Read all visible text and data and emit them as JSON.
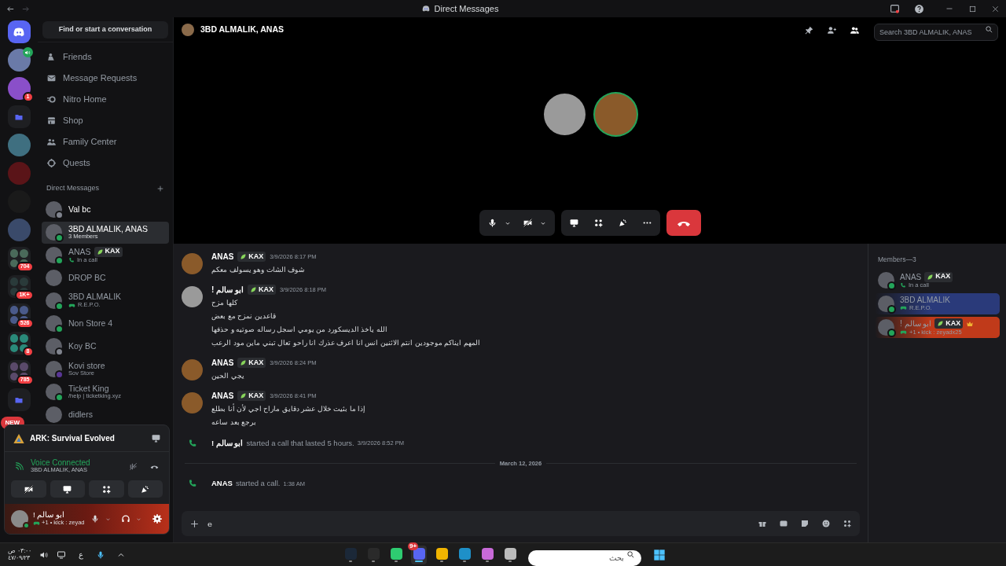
{
  "window": {
    "title": "Direct Messages"
  },
  "servers": [
    {
      "kind": "home",
      "color": "#5865f2"
    },
    {
      "kind": "avatar",
      "color": "#6a7aa8",
      "voice": true
    },
    {
      "kind": "avatar",
      "color": "#8a4fc9",
      "badge": "1"
    },
    {
      "kind": "folder",
      "color": "#5865f2"
    },
    {
      "kind": "avatar",
      "color": "#3f6f80"
    },
    {
      "kind": "avatar",
      "color": "#5a1418"
    },
    {
      "kind": "avatar",
      "color": "#1a1a1a"
    },
    {
      "kind": "avatar",
      "color": "#3a4a6a"
    },
    {
      "kind": "group",
      "color": "#4a6a5a",
      "badge": "704"
    },
    {
      "kind": "group",
      "color": "#2a3a3a",
      "badge": "1K+"
    },
    {
      "kind": "group",
      "color": "#4a5a8a",
      "badge": "526"
    },
    {
      "kind": "group",
      "color": "#2a8a7a",
      "badge": "8"
    },
    {
      "kind": "group",
      "color": "#5a4a6a",
      "badge": "785"
    },
    {
      "kind": "folder",
      "color": "#5865f2"
    },
    {
      "kind": "new",
      "color": "#da373c",
      "badge": "NEW"
    }
  ],
  "search": {
    "placeholder": "Find or start a conversation"
  },
  "nav": [
    {
      "label": "Friends"
    },
    {
      "label": "Message Requests"
    },
    {
      "label": "Nitro Home"
    },
    {
      "label": "Shop"
    },
    {
      "label": "Family Center"
    },
    {
      "label": "Quests"
    }
  ],
  "dm_header": "Direct Messages",
  "dms": [
    {
      "name": "Val bc",
      "kind": "plain",
      "color": "#80848e",
      "selected": false
    },
    {
      "name": "3BD ALMALIK, ANAS",
      "sub": "3 Members",
      "kind": "text",
      "color": "#23a55a",
      "selected": true
    },
    {
      "name": "ANAS",
      "sub": "In a call",
      "tag": "KAX",
      "kind": "call",
      "color": "#23a55a",
      "selected": false
    },
    {
      "name": "DROP BC",
      "kind": "plain",
      "selected": false
    },
    {
      "name": "3BD ALMALIK",
      "sub": "R.E.P.O.",
      "kind": "game",
      "color": "#23a55a",
      "selected": false
    },
    {
      "name": "Non Store 4",
      "kind": "plain",
      "color": "#23a55a",
      "selected": false
    },
    {
      "name": "Koy BC",
      "kind": "plain",
      "color": "#80848e",
      "selected": false
    },
    {
      "name": "Kovi store",
      "sub": "Sov Store",
      "kind": "text",
      "color": "#593695",
      "selected": false
    },
    {
      "name": "Ticket King",
      "sub": "/help | ticketking.xyz",
      "kind": "text",
      "color": "#23a55a",
      "selected": false
    },
    {
      "name": "didlers",
      "kind": "plain",
      "selected": false
    }
  ],
  "activity": {
    "game": "ARK: Survival Evolved"
  },
  "voice": {
    "status": "Voice Connected",
    "channel": "3BD ALMALIK, ANAS"
  },
  "user": {
    "name": "ابو سالم !",
    "status": "+1 • kick : zeyad"
  },
  "header": {
    "title": "3BD ALMALIK, ANAS",
    "search_placeholder": "Search 3BD ALMALIK, ANAS"
  },
  "call": {
    "participants": [
      {
        "color": "#9a9a9a",
        "speaking": false
      },
      {
        "color": "#8a5a2a",
        "speaking": true
      }
    ]
  },
  "messages": [
    {
      "kind": "message",
      "author": "ANAS",
      "tag": "KAX",
      "time": "3/9/2026 8:17 PM",
      "color": "#8a5a2a",
      "lines": [
        "شوف الشات وهو يسولف معكم"
      ]
    },
    {
      "kind": "message",
      "author": "ابو سالم !",
      "tag": "KAX",
      "time": "3/9/2026 8:18 PM",
      "color": "#9a9a9a",
      "lines": [
        "كلها مزح",
        "قاعدين نمزح مع بعض",
        "الله ياخذ الديسكورد من يومي اسجل رساله صوتيه و حذفها",
        "المهم ايناكم موجودين انتم الاثنين انس انا اعرف عذرك انا راحو تعال تبني ماين مود الرعب"
      ]
    },
    {
      "kind": "message",
      "author": "ANAS",
      "tag": "KAX",
      "time": "3/9/2026 8:24 PM",
      "color": "#8a5a2a",
      "lines": [
        "يجي الحين"
      ]
    },
    {
      "kind": "message",
      "author": "ANAS",
      "tag": "KAX",
      "time": "3/9/2026 8:41 PM",
      "color": "#8a5a2a",
      "lines": [
        "إذا ما بثيت خلال عشر دقايق ماراح اجي لأن أنا بطلع",
        "برجع بعد ساعه"
      ]
    },
    {
      "kind": "call",
      "author": "ابو سالم !",
      "text": "started a call that lasted 5 hours.",
      "time": "3/9/2026 8:52 PM"
    },
    {
      "kind": "divider",
      "text": "March 12, 2026"
    },
    {
      "kind": "call",
      "author": "ANAS",
      "text": "started a call.",
      "time": "1:38 AM"
    }
  ],
  "composer": {
    "value": "e"
  },
  "members": {
    "heading": "Members—3",
    "items": [
      {
        "name": "ANAS",
        "tag": "KAX",
        "crown": false,
        "sub": "In a call",
        "kind": "call"
      },
      {
        "name": "3BD ALMALIK",
        "crown": false,
        "sub": "R.E.P.O.",
        "kind": "game",
        "color": "#2a3a7a"
      },
      {
        "name": "ابو سالم !",
        "tag": "KAX",
        "crown": true,
        "sub": "+1 • kick : zeyadx25",
        "kind": "game",
        "color": "#c03a1a"
      }
    ]
  },
  "taskbar": {
    "time": "٠٣:٠٠ ص",
    "date": "٤٧/٠٩/٢٣",
    "language": "ع",
    "search_placeholder": "بحث",
    "apps": [
      {
        "color": "#1b2838",
        "active": false
      },
      {
        "color": "#2a2a2a",
        "active": false
      },
      {
        "color": "#2ecc71",
        "active": false
      },
      {
        "color": "#5865f2",
        "badge": "9+",
        "active": true
      },
      {
        "color": "#f0b400",
        "active": false
      },
      {
        "color": "#1e90c8",
        "active": false
      },
      {
        "color": "#c86ad8",
        "active": false
      },
      {
        "color": "#bbbbbb",
        "active": false
      }
    ]
  }
}
